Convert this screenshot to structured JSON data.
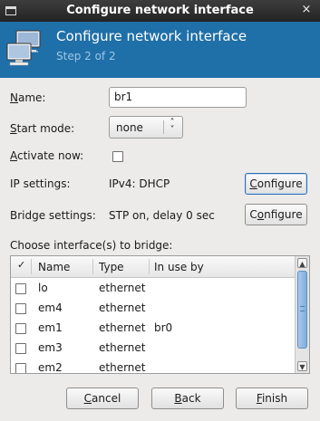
{
  "window": {
    "title": "Configure network interface",
    "close_glyph": "×",
    "menu_icon": "window-menu-icon"
  },
  "banner": {
    "heading": "Configure network interface",
    "step": "Step 2 of 2",
    "icon": "network-computers-icon",
    "bg_color": "#1f6fa8"
  },
  "form": {
    "name_label_pre": "",
    "name_label_u": "N",
    "name_label_post": "ame:",
    "name_value": "br1",
    "start_label_u": "S",
    "start_label_post": "tart mode:",
    "start_mode_value": "none",
    "activate_label_u": "A",
    "activate_label_post": "ctivate now:",
    "activate_checked": false,
    "ip_label": "IP settings:",
    "ip_value": "IPv4: DHCP",
    "ip_button_u": "C",
    "ip_button_post": "onfigure",
    "bridge_label": "Bridge settings:",
    "bridge_value": "STP on, delay 0 sec",
    "bridge_button_pre": "C",
    "bridge_button_u": "o",
    "bridge_button_post": "nfigure",
    "choose_label": "Choose interface(s) to bridge:"
  },
  "table": {
    "columns": [
      "Name",
      "Type",
      "In use by"
    ],
    "sort_glyph": "✓",
    "rows": [
      {
        "name": "lo",
        "type": "ethernet",
        "in_use_by": ""
      },
      {
        "name": "em4",
        "type": "ethernet",
        "in_use_by": ""
      },
      {
        "name": "em1",
        "type": "ethernet",
        "in_use_by": "br0"
      },
      {
        "name": "em3",
        "type": "ethernet",
        "in_use_by": ""
      },
      {
        "name": "em2",
        "type": "ethernet",
        "in_use_by": ""
      }
    ]
  },
  "buttons": {
    "cancel_u": "C",
    "cancel_post": "ancel",
    "back_u": "B",
    "back_post": "ack",
    "finish_u": "F",
    "finish_post": "inish"
  }
}
